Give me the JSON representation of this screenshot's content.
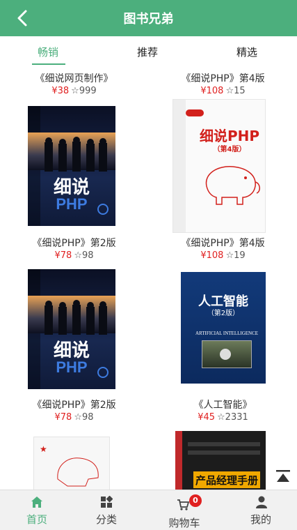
{
  "header": {
    "title": "图书兄弟",
    "back_icon": "chevron-left-icon"
  },
  "tabs": [
    {
      "label": "畅销",
      "active": true
    },
    {
      "label": "推荐",
      "active": false
    },
    {
      "label": "精选",
      "active": false
    }
  ],
  "books": [
    {
      "name": "《细说网页制作》",
      "price": "¥38",
      "stars": "☆999"
    },
    {
      "name": "《细说PHP》第4版",
      "price": "¥108",
      "stars": "☆15"
    },
    {
      "name": "《细说PHP》第2版",
      "price": "¥78",
      "stars": "☆98"
    },
    {
      "name": "《细说PHP》第4版",
      "price": "¥108",
      "stars": "☆19"
    },
    {
      "name": "《细说PHP》第2版",
      "price": "¥78",
      "stars": "☆98"
    },
    {
      "name": "《人工智能》",
      "price": "¥45",
      "stars": "☆2331"
    }
  ],
  "covers": {
    "php2": {
      "title": "细说",
      "sub": "PHP"
    },
    "php4": {
      "title": "细说PHP",
      "edition": "（第4版）"
    },
    "ai": {
      "title": "人工智能",
      "edition": "（第2版）",
      "en": "ARTIFICIAL INTELLIGENCE"
    },
    "pm": {
      "title": "产品经理手册"
    }
  },
  "bottom_nav": [
    {
      "label": "首页",
      "icon": "home-icon",
      "active": true
    },
    {
      "label": "分类",
      "icon": "category-icon",
      "active": false
    },
    {
      "label": "购物车",
      "icon": "cart-icon",
      "active": false,
      "badge": "0"
    },
    {
      "label": "我的",
      "icon": "user-icon",
      "active": false
    }
  ],
  "colors": {
    "primary": "#4caf7d",
    "price": "#e02020"
  }
}
